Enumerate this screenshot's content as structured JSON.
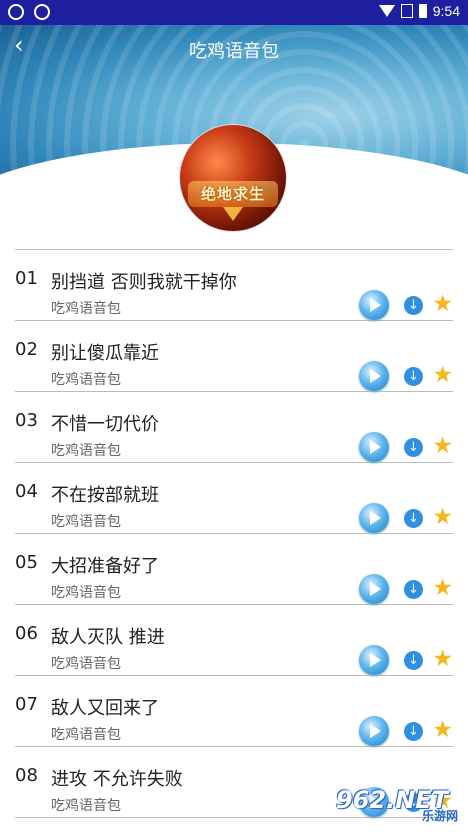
{
  "status": {
    "time": "9:54"
  },
  "header": {
    "title": "吃鸡语音包",
    "back_icon": "chevron-left-icon"
  },
  "avatar": {
    "text": "绝地求生"
  },
  "items": [
    {
      "num": "01",
      "name": "别挡道 否则我就干掉你",
      "sub": "吃鸡语音包"
    },
    {
      "num": "02",
      "name": "别让傻瓜靠近",
      "sub": "吃鸡语音包"
    },
    {
      "num": "03",
      "name": "不惜一切代价",
      "sub": "吃鸡语音包"
    },
    {
      "num": "04",
      "name": "不在按部就班",
      "sub": "吃鸡语音包"
    },
    {
      "num": "05",
      "name": "大招准备好了",
      "sub": "吃鸡语音包"
    },
    {
      "num": "06",
      "name": "敌人灭队 推进",
      "sub": "吃鸡语音包"
    },
    {
      "num": "07",
      "name": "敌人又回来了",
      "sub": "吃鸡语音包"
    },
    {
      "num": "08",
      "name": "进攻 不允许失败",
      "sub": "吃鸡语音包"
    }
  ],
  "watermark": {
    "brand": "962.NET",
    "sub": "乐游网"
  },
  "colors": {
    "statusbar": "#1d1f9e",
    "star": "#f7b61a",
    "download": "#2f8fe0",
    "play": "#1d7ccc"
  }
}
